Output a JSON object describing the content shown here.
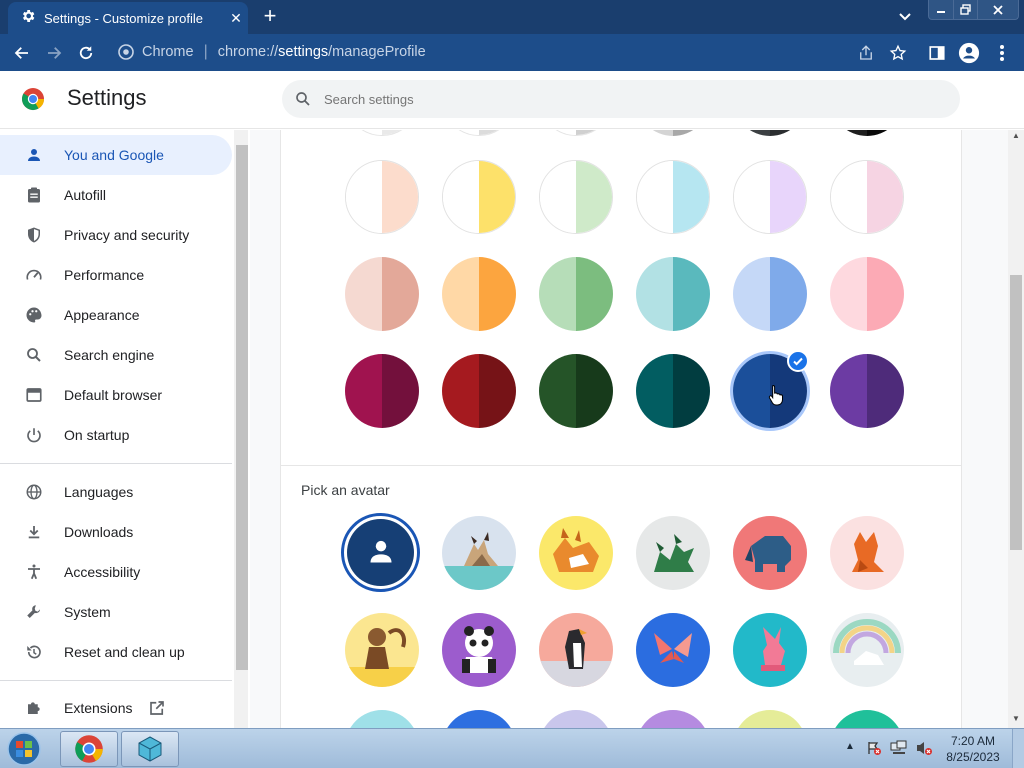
{
  "browser": {
    "tab_title": "Settings - Customize profile",
    "omnibox_chip": "Chrome",
    "url_prefix": "chrome://",
    "url_host": "settings",
    "url_path": "/manageProfile"
  },
  "header": {
    "title": "Settings",
    "search_placeholder": "Search settings"
  },
  "sidebar": {
    "items": [
      {
        "label": "You and Google",
        "icon": "person-icon",
        "active": true
      },
      {
        "label": "Autofill",
        "icon": "clipboard-icon"
      },
      {
        "label": "Privacy and security",
        "icon": "shield-icon"
      },
      {
        "label": "Performance",
        "icon": "speedometer-icon"
      },
      {
        "label": "Appearance",
        "icon": "palette-icon"
      },
      {
        "label": "Search engine",
        "icon": "search-icon"
      },
      {
        "label": "Default browser",
        "icon": "browser-window-icon"
      },
      {
        "label": "On startup",
        "icon": "power-icon"
      },
      {
        "label": "Languages",
        "icon": "globe-icon"
      },
      {
        "label": "Downloads",
        "icon": "download-icon"
      },
      {
        "label": "Accessibility",
        "icon": "accessibility-icon"
      },
      {
        "label": "System",
        "icon": "wrench-icon"
      },
      {
        "label": "Reset and clean up",
        "icon": "restore-icon"
      },
      {
        "label": "Extensions",
        "icon": "puzzle-icon"
      }
    ]
  },
  "main": {
    "avatar_heading": "Pick an avatar",
    "color_rows": [
      [
        {
          "left": "#ffffff",
          "right": "#fcdccc"
        },
        {
          "left": "#ffffff",
          "right": "#fde16a"
        },
        {
          "left": "#ffffff",
          "right": "#cfeac9"
        },
        {
          "left": "#ffffff",
          "right": "#b6e6f1"
        },
        {
          "left": "#ffffff",
          "right": "#e8d5fb"
        },
        {
          "left": "#ffffff",
          "right": "#f6d4e3"
        }
      ],
      [
        {
          "left": "#f5d9d1",
          "right": "#e3a899"
        },
        {
          "left": "#ffd8a6",
          "right": "#fca53f"
        },
        {
          "left": "#b6ddb8",
          "right": "#7cbd7f"
        },
        {
          "left": "#b2e1e4",
          "right": "#5ab9bd"
        },
        {
          "left": "#c5d8f7",
          "right": "#7faaea"
        },
        {
          "left": "#fed9df",
          "right": "#fcaab5"
        }
      ],
      [
        {
          "left": "#a0134f",
          "right": "#73103c"
        },
        {
          "left": "#a51a1f",
          "right": "#761317"
        },
        {
          "left": "#255428",
          "right": "#173a1b"
        },
        {
          "left": "#025d61",
          "right": "#013d40"
        },
        {
          "left": "#1b4f9a",
          "right": "#14397a",
          "selected": true
        },
        {
          "left": "#6c3ba3",
          "right": "#4e2b7a"
        }
      ]
    ],
    "avatars": [
      {
        "icon": "default-person-avatar-icon",
        "selected": true
      },
      {
        "icon": "cat-avatar-icon"
      },
      {
        "icon": "corgi-avatar-icon"
      },
      {
        "icon": "dragon-avatar-icon"
      },
      {
        "icon": "elephant-avatar-icon"
      },
      {
        "icon": "fox-avatar-icon"
      },
      {
        "icon": "monkey-avatar-icon"
      },
      {
        "icon": "panda-avatar-icon"
      },
      {
        "icon": "penguin-avatar-icon"
      },
      {
        "icon": "butterfly-avatar-icon"
      },
      {
        "icon": "rabbit-avatar-icon"
      },
      {
        "icon": "unicorn-avatar-icon"
      }
    ]
  },
  "taskbar": {
    "time": "7:20 AM",
    "date": "8/25/2023"
  }
}
